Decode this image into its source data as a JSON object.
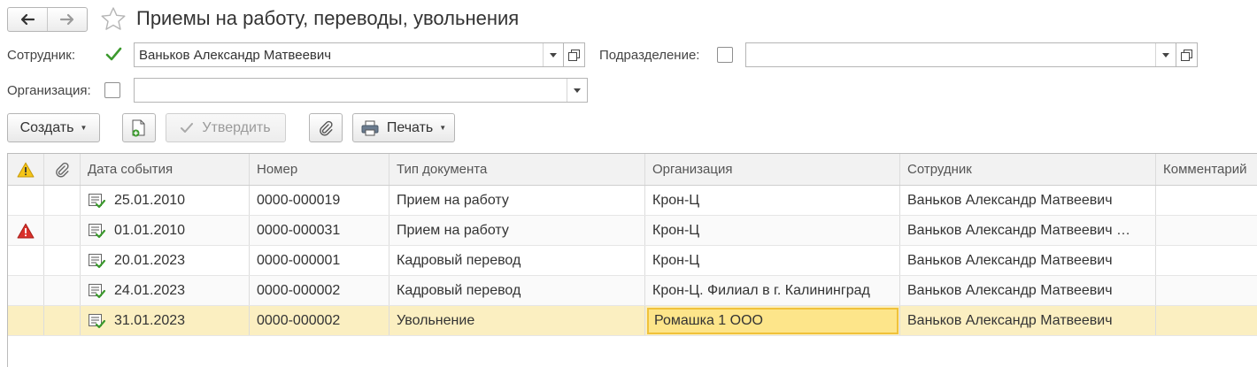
{
  "window": {
    "title": "Приемы на работу, переводы, увольнения"
  },
  "filters": {
    "employee_label": "Сотрудник:",
    "employee_checked": true,
    "employee_value": "Ваньков Александр Матвеевич",
    "department_label": "Подразделение:",
    "department_checked": false,
    "department_value": "",
    "organization_label": "Организация:",
    "organization_checked": false,
    "organization_value": ""
  },
  "toolbar": {
    "create_label": "Создать",
    "approve_label": "Утвердить",
    "print_label": "Печать"
  },
  "table": {
    "columns": [
      "Дата события",
      "Номер",
      "Тип документа",
      "Организация",
      "Сотрудник",
      "Комментарий"
    ],
    "rows": [
      {
        "warning": false,
        "date": "25.01.2010",
        "number": "0000-000019",
        "type": "Прием на работу",
        "organization": "Крон-Ц",
        "employee": "Ваньков Александр Матвеевич",
        "comment": ""
      },
      {
        "warning": true,
        "date": "01.01.2010",
        "number": "0000-000031",
        "type": "Прием на работу",
        "organization": "Крон-Ц",
        "employee": "Ваньков Александр Матвеевич …",
        "comment": ""
      },
      {
        "warning": false,
        "date": "20.01.2023",
        "number": "0000-000001",
        "type": "Кадровый перевод",
        "organization": "Крон-Ц",
        "employee": "Ваньков Александр Матвеевич",
        "comment": ""
      },
      {
        "warning": false,
        "date": "24.01.2023",
        "number": "0000-000002",
        "type": "Кадровый перевод",
        "organization": "Крон-Ц. Филиал в г. Калининград",
        "employee": "Ваньков Александр Матвеевич",
        "comment": ""
      },
      {
        "warning": false,
        "date": "31.01.2023",
        "number": "0000-000002",
        "type": "Увольнение",
        "organization": "Ромашка 1 ООО",
        "employee": "Ваньков Александр Матвеевич",
        "comment": ""
      }
    ],
    "selected_row": 4
  },
  "icons": {
    "back": "arrow-left-icon",
    "forward": "arrow-right-icon",
    "favorite": "star-icon",
    "warning_header": "warning-icon",
    "attachment_header": "paperclip-icon",
    "document": "document-posted-icon",
    "error": "error-triangle-icon"
  },
  "colors": {
    "selected_row": "#fbefc1",
    "focused_cell": "#fde58a",
    "focus_border": "#f0c23a",
    "check_green": "#3c9a2e",
    "warning_yellow": "#f5c518",
    "error_red": "#d9312b"
  }
}
